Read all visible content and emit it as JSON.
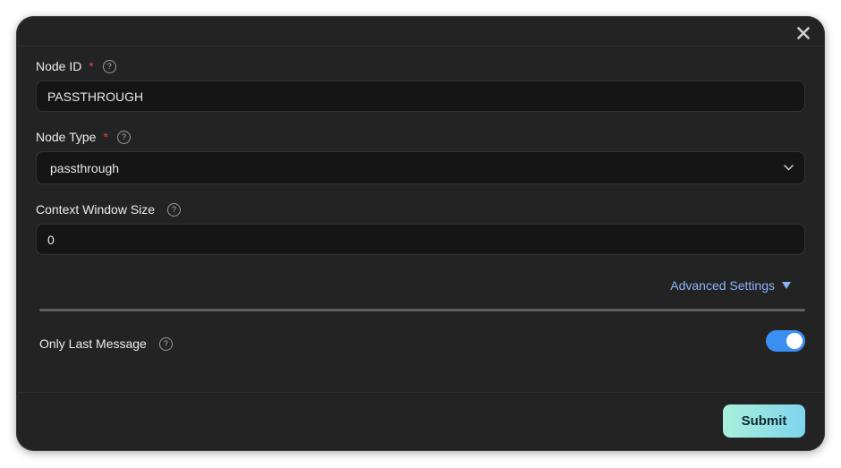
{
  "modal": {
    "close_icon": "close-icon",
    "node_id": {
      "label": "Node ID",
      "required_mark": "*",
      "help": "?",
      "value": "PASSTHROUGH"
    },
    "node_type": {
      "label": "Node Type",
      "required_mark": "*",
      "help": "?",
      "value": "passthrough",
      "chevron_icon": "chevron-down-icon"
    },
    "context_window": {
      "label": "Context Window Size",
      "help": "?",
      "value": "0"
    },
    "advanced": {
      "label": "Advanced Settings",
      "icon": "triangle-down-icon"
    },
    "only_last_message": {
      "label": "Only Last Message",
      "help": "?",
      "enabled": true
    },
    "submit_label": "Submit"
  },
  "colors": {
    "modal_bg": "#232323",
    "field_bg": "#151515",
    "accent_link": "#8ab4f8",
    "required": "#ef4444",
    "toggle_on": "#3b8ef2",
    "submit_gradient_start": "#a9f0da",
    "submit_gradient_end": "#7fd4ef"
  }
}
